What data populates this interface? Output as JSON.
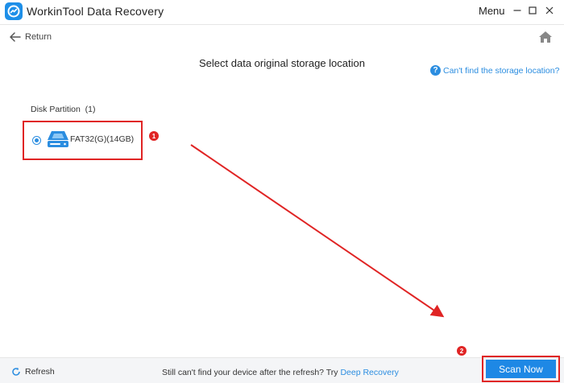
{
  "window": {
    "title": "WorkinTool Data Recovery",
    "menu_label": "Menu",
    "logo_icon": "workintool-logo-icon",
    "minimize_icon": "minimize-icon",
    "maximize_icon": "maximize-icon",
    "close_icon": "close-icon"
  },
  "nav": {
    "return_label": "Return",
    "return_icon": "arrow-left-icon",
    "home_icon": "home-icon"
  },
  "main": {
    "title": "Select data original storage location",
    "help_link": "Can't find the storage location?",
    "help_icon": "question-icon"
  },
  "partitions": {
    "section_label": "Disk Partition  (1)",
    "items": [
      {
        "label": "FAT32(G)(14GB)",
        "selected": true,
        "icon": "disk-drive-icon"
      }
    ]
  },
  "annotations": {
    "step1": "1",
    "step2": "2",
    "accent_color": "#e02424"
  },
  "footer": {
    "refresh_label": "Refresh",
    "refresh_icon": "refresh-icon",
    "message": "Still can't find your device after the refresh? Try ",
    "deep_recovery_link": "Deep Recovery",
    "scan_button": "Scan Now"
  },
  "colors": {
    "brand": "#1e88e5",
    "link": "#2b8de0",
    "highlight": "#e02424"
  }
}
